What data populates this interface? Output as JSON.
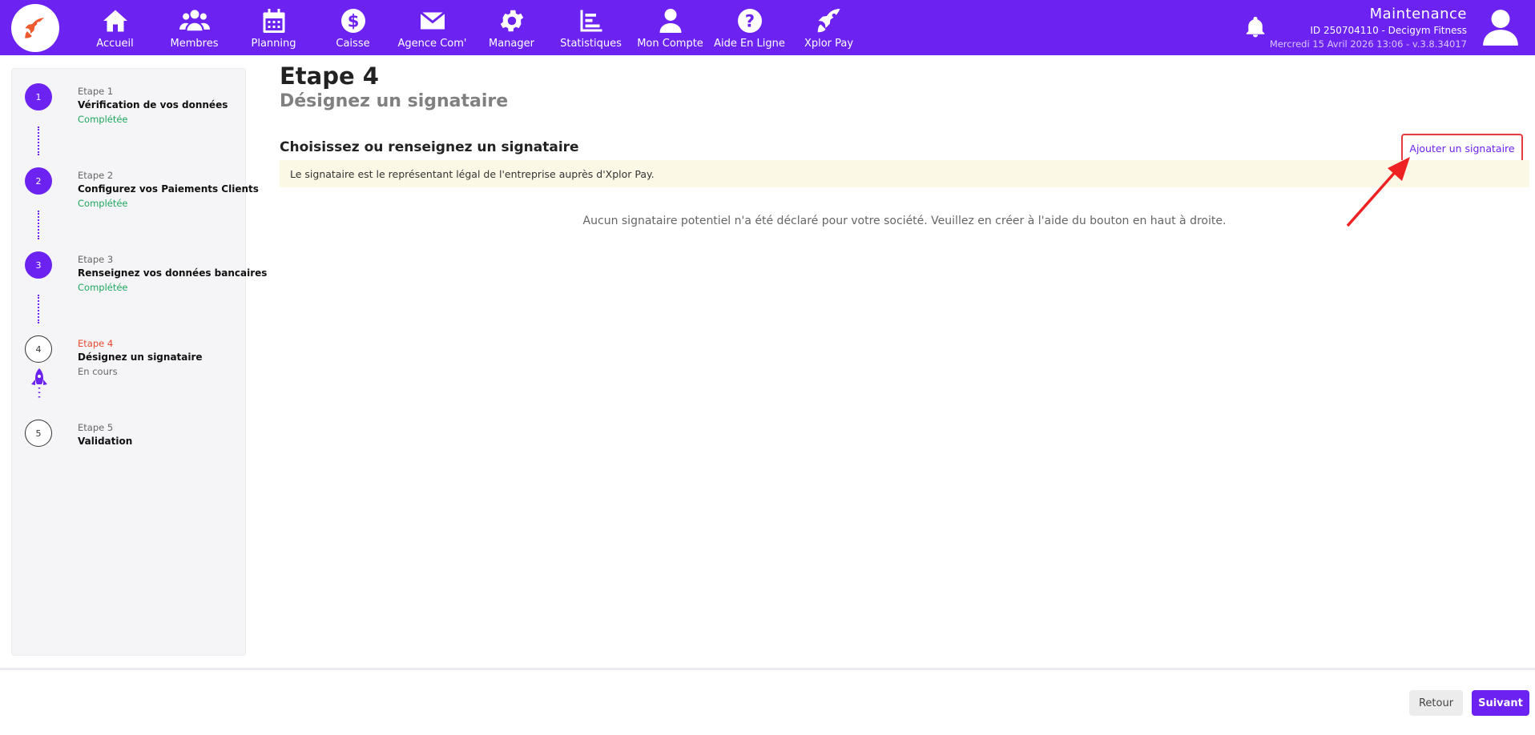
{
  "nav": {
    "items": [
      {
        "label": "Accueil",
        "icon": "home-icon"
      },
      {
        "label": "Membres",
        "icon": "users-icon"
      },
      {
        "label": "Planning",
        "icon": "calendar-icon"
      },
      {
        "label": "Caisse",
        "icon": "dollar-icon"
      },
      {
        "label": "Agence Com'",
        "icon": "envelope-icon"
      },
      {
        "label": "Manager",
        "icon": "gear-icon"
      },
      {
        "label": "Statistiques",
        "icon": "bar-chart-icon"
      },
      {
        "label": "Mon Compte",
        "icon": "user-icon"
      },
      {
        "label": "Aide En Ligne",
        "icon": "question-icon"
      },
      {
        "label": "Xplor Pay",
        "icon": "rocket-icon"
      }
    ]
  },
  "user": {
    "name": "Maintenance",
    "id_line": "ID 250704110 - Decigym Fitness",
    "date_line": "Mercredi 15 Avril 2026 13:06 - v.3.8.34017"
  },
  "steps": [
    {
      "num": "1",
      "kicker": "Etape 1",
      "title": "Vérification de vos données",
      "status": "Complétée"
    },
    {
      "num": "2",
      "kicker": "Etape 2",
      "title": "Configurez vos Paiements Clients",
      "status": "Complétée"
    },
    {
      "num": "3",
      "kicker": "Etape 3",
      "title": "Renseignez vos données bancaires",
      "status": "Complétée"
    },
    {
      "num": "4",
      "kicker": "Etape 4",
      "title": "Désignez un signataire",
      "status": "En cours"
    },
    {
      "num": "5",
      "kicker": "Etape 5",
      "title": "Validation",
      "status": ""
    }
  ],
  "main": {
    "step_heading": "Etape 4",
    "step_subheading": "Désignez un signataire",
    "section_title": "Choisissez ou renseignez un signataire",
    "add_button": "Ajouter un signataire",
    "info": "Le signataire est le représentant légal de l'entreprise auprès d'Xplor Pay.",
    "empty": "Aucun signataire potentiel n'a été déclaré pour votre société. Veuillez en créer à l'aide du bouton en haut à droite."
  },
  "footer": {
    "back": "Retour",
    "next": "Suivant"
  },
  "colors": {
    "brand": "#6c22f0",
    "success": "#20a75d",
    "active": "#e8492f",
    "highlight": "#e63b3b"
  }
}
